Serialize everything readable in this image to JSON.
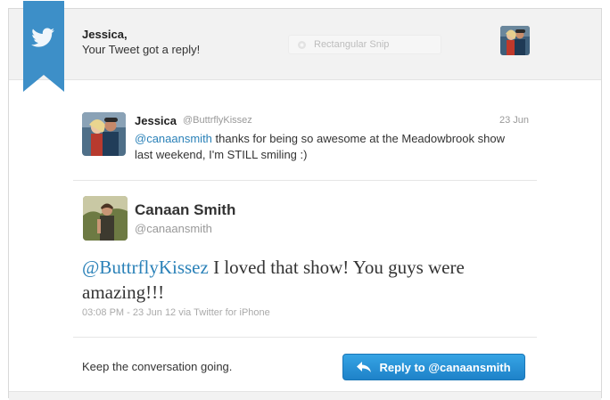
{
  "notification": {
    "greeting": "Jessica,",
    "message": "Your Tweet got a reply!"
  },
  "overlay": {
    "snip_label": "Rectangular Snip"
  },
  "original_tweet": {
    "name": "Jessica",
    "handle": "@ButtrflyKissez",
    "date": "23 Jun",
    "mention": "@canaansmith",
    "text": " thanks for being so awesome at the Meadowbrook show last weekend, I'm STILL smiling :)"
  },
  "reply": {
    "name": "Canaan Smith",
    "handle": "@canaansmith",
    "mention": "@ButtrflyKissez",
    "text": " I loved that show! You guys were amazing!!!",
    "meta": "03:08 PM - 23 Jun 12 via Twitter for iPhone"
  },
  "footer": {
    "prompt": "Keep the conversation going.",
    "reply_button_label": "Reply to @canaansmith"
  },
  "colors": {
    "brand": "#2a81b8",
    "ribbon": "#3d8fc8",
    "button": "#2b95d8"
  },
  "icons": {
    "ribbon": "twitter-bird-icon",
    "button": "reply-arrow-icon",
    "snip": "record-dot-icon"
  }
}
